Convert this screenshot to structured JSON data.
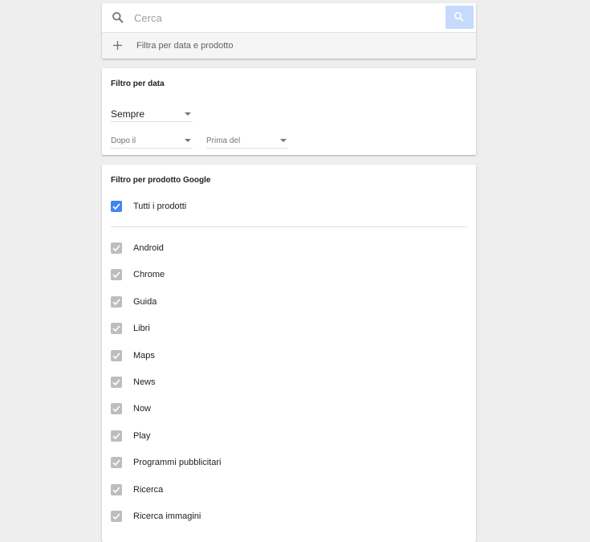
{
  "search": {
    "placeholder": "Cerca",
    "add_filter_label": "Filtra per data e prodotto"
  },
  "date_filter": {
    "title": "Filtro per data",
    "range_select": "Sempre",
    "after_select": "Dopo il",
    "before_select": "Prima del"
  },
  "product_filter": {
    "title": "Filtro per prodotto Google",
    "all_products": {
      "label": "Tutti i prodotti",
      "checked": true
    },
    "products": [
      {
        "label": "Android",
        "checked": true
      },
      {
        "label": "Chrome",
        "checked": true
      },
      {
        "label": "Guida",
        "checked": true
      },
      {
        "label": "Libri",
        "checked": true
      },
      {
        "label": "Maps",
        "checked": true
      },
      {
        "label": "News",
        "checked": true
      },
      {
        "label": "Now",
        "checked": true
      },
      {
        "label": "Play",
        "checked": true
      },
      {
        "label": "Programmi pubblicitari",
        "checked": true
      },
      {
        "label": "Ricerca",
        "checked": true
      },
      {
        "label": "Ricerca immagini",
        "checked": true
      }
    ]
  },
  "colors": {
    "accent": "#4285f4",
    "search_button": "#c6dafc",
    "disabled_checkbox": "#bdbdbd",
    "background": "#eeeeee"
  }
}
